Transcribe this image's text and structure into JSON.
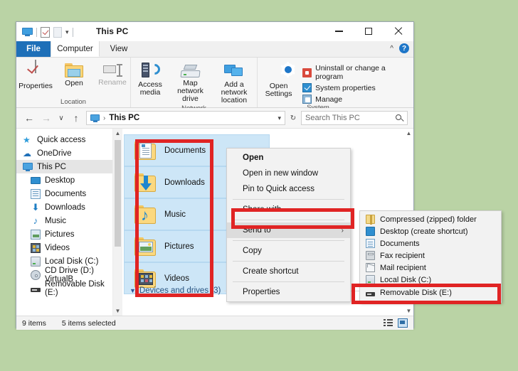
{
  "window": {
    "title": "This PC",
    "quick_access": [
      "monitor-icon",
      "properties-icon",
      "new-folder-icon",
      "dropdown-caret"
    ],
    "controls": {
      "minimize": "minimize",
      "maximize": "maximize",
      "close": "close"
    }
  },
  "ribbon": {
    "tabs": [
      {
        "label": "File",
        "active": false,
        "style": "file"
      },
      {
        "label": "Computer",
        "active": true,
        "style": "normal"
      },
      {
        "label": "View",
        "active": false,
        "style": "normal"
      }
    ],
    "help_label": "?",
    "groups": [
      {
        "name": "Location",
        "buttons": [
          {
            "label": "Properties",
            "disabled": false
          },
          {
            "label": "Open",
            "disabled": false
          },
          {
            "label": "Rename",
            "disabled": true
          }
        ]
      },
      {
        "name": "Network",
        "buttons": [
          {
            "label": "Access media",
            "disabled": false
          },
          {
            "label": "Map network drive",
            "disabled": false
          },
          {
            "label": "Add a network location",
            "disabled": false
          }
        ]
      },
      {
        "name": "System",
        "buttons": [
          {
            "label": "Open Settings",
            "disabled": false
          }
        ],
        "small_items": [
          {
            "label": "Uninstall or change a program"
          },
          {
            "label": "System properties"
          },
          {
            "label": "Manage"
          }
        ]
      }
    ]
  },
  "address_bar": {
    "breadcrumb": "This PC",
    "search_placeholder": "Search This PC",
    "back": "←",
    "forward": "→",
    "history": "∨",
    "up": "↑",
    "refresh": "↻"
  },
  "nav_pane": {
    "items": [
      {
        "label": "Quick access",
        "icon": "star-icon",
        "indent": false,
        "selected": false
      },
      {
        "label": "OneDrive",
        "icon": "cloud-icon",
        "indent": false,
        "selected": false
      },
      {
        "label": "This PC",
        "icon": "pc-icon",
        "indent": false,
        "selected": true
      },
      {
        "label": "Desktop",
        "icon": "desktop-icon",
        "indent": true,
        "selected": false
      },
      {
        "label": "Documents",
        "icon": "documents-icon",
        "indent": true,
        "selected": false
      },
      {
        "label": "Downloads",
        "icon": "downloads-icon",
        "indent": true,
        "selected": false
      },
      {
        "label": "Music",
        "icon": "music-icon",
        "indent": true,
        "selected": false
      },
      {
        "label": "Pictures",
        "icon": "pictures-icon",
        "indent": true,
        "selected": false
      },
      {
        "label": "Videos",
        "icon": "videos-icon",
        "indent": true,
        "selected": false
      },
      {
        "label": "Local Disk (C:)",
        "icon": "harddisk-icon",
        "indent": true,
        "selected": false
      },
      {
        "label": "CD Drive (D:) VirtualB",
        "icon": "cd-drive-icon",
        "indent": true,
        "selected": false
      },
      {
        "label": "Removable Disk (E:)",
        "icon": "usb-drive-icon",
        "indent": true,
        "selected": false
      }
    ]
  },
  "content": {
    "folders": [
      {
        "name": "Documents",
        "icon": "documents-folder-icon",
        "selected": true
      },
      {
        "name": "Downloads",
        "icon": "downloads-folder-icon",
        "selected": true
      },
      {
        "name": "Music",
        "icon": "music-folder-icon",
        "selected": true
      },
      {
        "name": "Pictures",
        "icon": "pictures-folder-icon",
        "selected": true
      },
      {
        "name": "Videos",
        "icon": "videos-folder-icon",
        "selected": true
      }
    ],
    "group_header": "Devices and drives (3)"
  },
  "context_menu": {
    "items": [
      {
        "label": "Open",
        "bold": true,
        "submenu": false,
        "highlighted": false
      },
      {
        "label": "Open in new window",
        "bold": false,
        "submenu": false,
        "highlighted": false
      },
      {
        "label": "Pin to Quick access",
        "bold": false,
        "submenu": false,
        "highlighted": false
      },
      {
        "label": "Share with",
        "bold": false,
        "submenu": true,
        "highlighted": false
      },
      {
        "label": "Send to",
        "bold": false,
        "submenu": true,
        "highlighted": true
      },
      {
        "label": "Copy",
        "bold": false,
        "submenu": false,
        "highlighted": false
      },
      {
        "label": "Create shortcut",
        "bold": false,
        "submenu": false,
        "highlighted": false
      },
      {
        "label": "Properties",
        "bold": false,
        "submenu": false,
        "highlighted": false
      }
    ],
    "submenu_arrow": "›"
  },
  "send_to_submenu": {
    "items": [
      {
        "label": "Compressed (zipped) folder",
        "icon": "zip-icon"
      },
      {
        "label": "Desktop (create shortcut)",
        "icon": "desktop-icon"
      },
      {
        "label": "Documents",
        "icon": "documents-icon"
      },
      {
        "label": "Fax recipient",
        "icon": "fax-icon"
      },
      {
        "label": "Mail recipient",
        "icon": "mail-icon"
      },
      {
        "label": "Local Disk (C:)",
        "icon": "harddisk-icon"
      },
      {
        "label": "Removable Disk (E:)",
        "icon": "usb-drive-icon"
      }
    ]
  },
  "status_bar": {
    "item_count": "9 items",
    "selection_count": "5 items selected",
    "views": [
      "details-view-icon",
      "large-icons-view-icon"
    ]
  },
  "colors": {
    "background": "#bad3a5",
    "annotation_red": "#e02424",
    "selection_blue": "#cde6f7",
    "file_tab_blue": "#1e6fb8",
    "group_header_blue": "#25517f"
  }
}
